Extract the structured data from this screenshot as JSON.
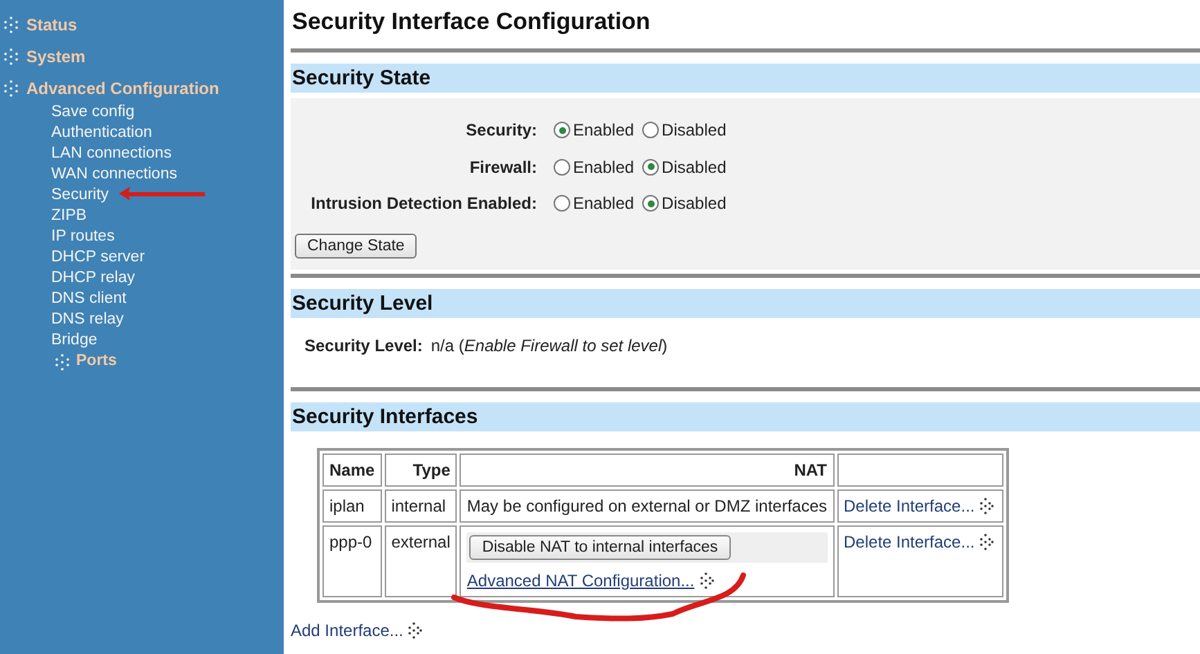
{
  "sidebar": {
    "items": [
      {
        "label": "Status"
      },
      {
        "label": "System"
      },
      {
        "label": "Advanced Configuration",
        "children": [
          {
            "label": "Save config"
          },
          {
            "label": "Authentication"
          },
          {
            "label": "LAN connections"
          },
          {
            "label": "WAN connections"
          },
          {
            "label": "Security"
          },
          {
            "label": "ZIPB"
          },
          {
            "label": "IP routes"
          },
          {
            "label": "DHCP server"
          },
          {
            "label": "DHCP relay"
          },
          {
            "label": "DNS client"
          },
          {
            "label": "DNS relay"
          },
          {
            "label": "Bridge",
            "children": [
              {
                "label": "Ports",
                "kind": "group"
              }
            ]
          }
        ]
      }
    ]
  },
  "page": {
    "title": "Security Interface Configuration"
  },
  "security_state": {
    "heading": "Security State",
    "rows": [
      {
        "label": "Security:",
        "options": [
          {
            "label": "Enabled",
            "selected": true
          },
          {
            "label": "Disabled",
            "selected": false
          }
        ]
      },
      {
        "label": "Firewall:",
        "options": [
          {
            "label": "Enabled",
            "selected": false
          },
          {
            "label": "Disabled",
            "selected": true
          }
        ]
      },
      {
        "label": "Intrusion Detection Enabled:",
        "options": [
          {
            "label": "Enabled",
            "selected": false
          },
          {
            "label": "Disabled",
            "selected": true
          }
        ]
      }
    ],
    "button": "Change State"
  },
  "security_level": {
    "heading": "Security Level",
    "label": "Security Level:",
    "value": "n/a (*Enable Firewall to set level*)"
  },
  "security_interfaces": {
    "heading": "Security Interfaces",
    "columns": [
      "Name",
      "Type",
      "NAT"
    ],
    "rows": [
      {
        "name": "iplan",
        "type": "internal",
        "nat": {
          "kind": "text",
          "text": "May be configured on external or DMZ interfaces"
        },
        "action": "Delete Interface..."
      },
      {
        "name": "ppp-0",
        "type": "external",
        "nat": {
          "kind": "controls",
          "button": "Disable NAT to internal interfaces",
          "link": "Advanced NAT Configuration..."
        },
        "action": "Delete Interface..."
      }
    ],
    "add_link": "Add Interface..."
  }
}
